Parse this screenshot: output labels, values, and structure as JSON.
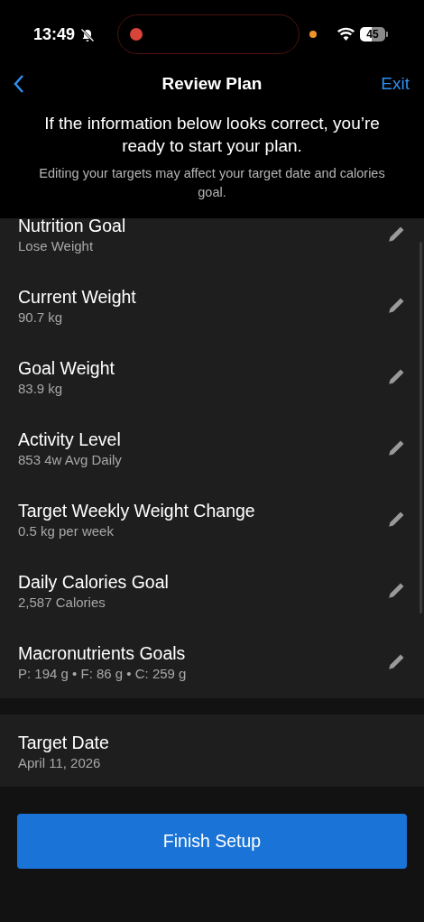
{
  "status_bar": {
    "time": "13:49",
    "battery": "45"
  },
  "nav": {
    "title": "Review Plan",
    "action": "Exit"
  },
  "intro": {
    "heading": "If the information below looks correct, you’re ready to start your plan.",
    "note": "Editing your targets may affect your target date and calories goal."
  },
  "settings": [
    {
      "title": "Nutrition Goal",
      "value": "Lose Weight",
      "editable": true
    },
    {
      "title": "Current Weight",
      "value": "90.7 kg",
      "editable": true
    },
    {
      "title": "Goal Weight",
      "value": "83.9 kg",
      "editable": true
    },
    {
      "title": "Activity Level",
      "value": "853 4w Avg Daily",
      "editable": true
    },
    {
      "title": "Target Weekly Weight Change",
      "value": "0.5 kg per week",
      "editable": true
    },
    {
      "title": "Daily Calories Goal",
      "value": "2,587 Calories",
      "editable": true
    },
    {
      "title": "Macronutrients Goals",
      "value": "P: 194 g • F: 86 g • C: 259 g",
      "editable": true
    }
  ],
  "target": {
    "title": "Target Date",
    "value": "April 11, 2026"
  },
  "primary_button": "Finish Setup"
}
